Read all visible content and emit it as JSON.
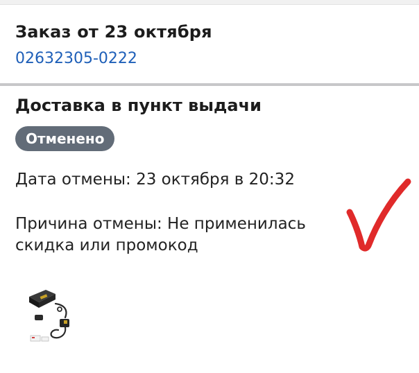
{
  "order": {
    "title": "Заказ от 23 октября",
    "number": "02632305-0222"
  },
  "delivery": {
    "title": "Доставка в пункт выдачи",
    "status": "Отменено",
    "cancel_date": "Дата отмены: 23 октября в 20:32",
    "cancel_reason": "Причина отмены: Не применилась скидка или промокод"
  },
  "colors": {
    "link": "#1e5fb8",
    "status_badge": "#626c78",
    "checkmark": "#e02a2a"
  },
  "icons": {
    "annotation": "red-checkmark-icon",
    "product": "product-thumbnail"
  }
}
